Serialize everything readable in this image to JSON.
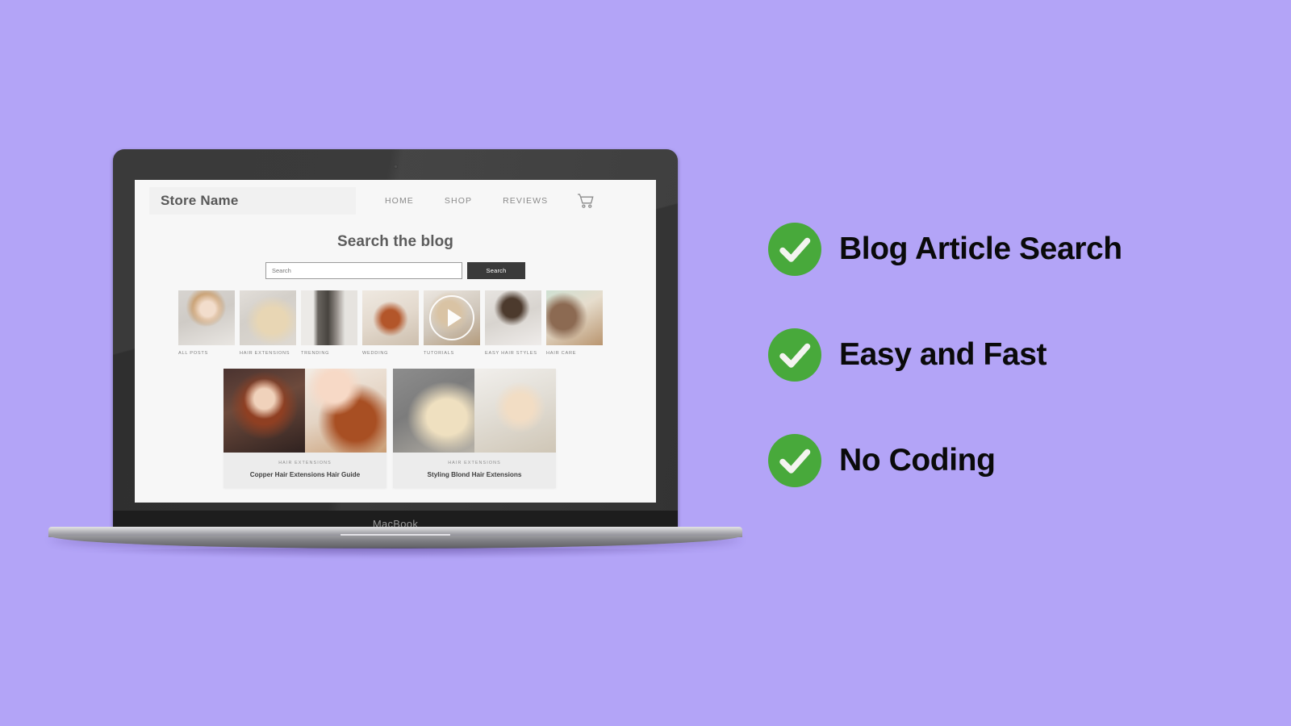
{
  "theme": {
    "background": "#b3a4f7",
    "accent_green": "#48a93b",
    "screen_bg": "#f7f7f7",
    "button_dark": "#3a3a3a"
  },
  "device": {
    "label": "MacBook",
    "webcam_icon": "webcam-dot-icon"
  },
  "site": {
    "store_name": "Store Name",
    "nav": [
      {
        "label": "HOME"
      },
      {
        "label": "SHOP"
      },
      {
        "label": "REVIEWS"
      }
    ],
    "cart_icon": "shopping-cart-icon",
    "page_title": "Search the blog",
    "search": {
      "placeholder": "Search",
      "value": "",
      "button_label": "Search"
    },
    "categories": [
      {
        "label": "ALL POSTS",
        "image": "woman-smiling-wavy-hair",
        "art": "p-allposts",
        "has_play": false
      },
      {
        "label": "HAIR EXTENSIONS",
        "image": "hand-on-long-blond-curls",
        "art": "p-ext",
        "has_play": false
      },
      {
        "label": "TRENDING",
        "image": "brush-through-straight-hair",
        "art": "p-trend",
        "has_play": false
      },
      {
        "label": "WEDDING",
        "image": "bridal-updo-with-pearls",
        "art": "p-wed",
        "has_play": false
      },
      {
        "label": "TUTORIALS",
        "image": "video-thumbnail-hair-styling",
        "art": "p-tut",
        "has_play": true
      },
      {
        "label": "EASY HAIR STYLES",
        "image": "high-ponytail-side-profile",
        "art": "p-easy",
        "has_play": false
      },
      {
        "label": "HAIR CARE",
        "image": "applying-hair-serum",
        "art": "p-care",
        "has_play": false
      }
    ],
    "posts": [
      {
        "category": "HAIR EXTENSIONS",
        "title": "Copper Hair Extensions Hair Guide",
        "images": [
          "redhead-portrait",
          "bride-with-floral-curls"
        ],
        "art": [
          "p-copper1",
          "p-copper2"
        ]
      },
      {
        "category": "HAIR EXTENSIONS",
        "title": "Styling Blond Hair Extensions",
        "images": [
          "combing-blond-extension-weft",
          "blond-woman-resting-on-hand"
        ],
        "art": [
          "p-blond1",
          "p-blond2"
        ]
      }
    ]
  },
  "features": [
    {
      "icon": "check-circle-icon",
      "label": "Blog Article Search"
    },
    {
      "icon": "check-circle-icon",
      "label": "Easy and Fast"
    },
    {
      "icon": "check-circle-icon",
      "label": "No Coding"
    }
  ]
}
